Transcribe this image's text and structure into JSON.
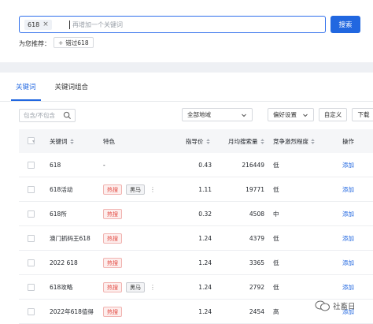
{
  "search": {
    "chip": "618",
    "chip_close": "×",
    "placeholder": "再增加一个关键词",
    "button": "搜索"
  },
  "recommend": {
    "label": "为您推荐：",
    "chip_plus": "+",
    "chip": "错过618"
  },
  "tabs": [
    "关键词",
    "关键词组合"
  ],
  "filters": {
    "include_placeholder": "包含/不包含",
    "region": "全部地域",
    "preference": "偏好设置",
    "custom": "自定义",
    "download": "下载"
  },
  "table": {
    "headers": [
      "关键词",
      "特色",
      "指导价",
      "月均搜索量",
      "竞争激烈程度",
      "操作"
    ],
    "rows": [
      {
        "keyword": "618",
        "feature": "-",
        "tags": [],
        "price": "0.43",
        "volume": "216449",
        "competition": "低",
        "action": "添加"
      },
      {
        "keyword": "618活动",
        "feature": "",
        "tags": [
          "热搜",
          "黑马"
        ],
        "price": "1.11",
        "volume": "19771",
        "competition": "低",
        "action": "添加"
      },
      {
        "keyword": "618所",
        "feature": "",
        "tags": [
          "热搜"
        ],
        "price": "0.32",
        "volume": "4508",
        "competition": "中",
        "action": "添加"
      },
      {
        "keyword": "澳门抓码王618",
        "feature": "",
        "tags": [
          "热搜"
        ],
        "price": "1.24",
        "volume": "4379",
        "competition": "低",
        "action": "添加"
      },
      {
        "keyword": "2022 618",
        "feature": "",
        "tags": [
          "热搜"
        ],
        "price": "1.24",
        "volume": "3365",
        "competition": "低",
        "action": "添加"
      },
      {
        "keyword": "618攻略",
        "feature": "",
        "tags": [
          "热搜",
          "黑马"
        ],
        "price": "1.24",
        "volume": "2792",
        "competition": "低",
        "action": "添加"
      },
      {
        "keyword": "2022年618值得",
        "feature": "",
        "tags": [
          "热搜"
        ],
        "price": "1.24",
        "volume": "2454",
        "competition": "高",
        "action": "添加"
      }
    ]
  },
  "watermark": "社畜日",
  "colors": {
    "accent": "#2167e0",
    "hot": "#e34d45",
    "page_bg": "#eef0f4"
  }
}
